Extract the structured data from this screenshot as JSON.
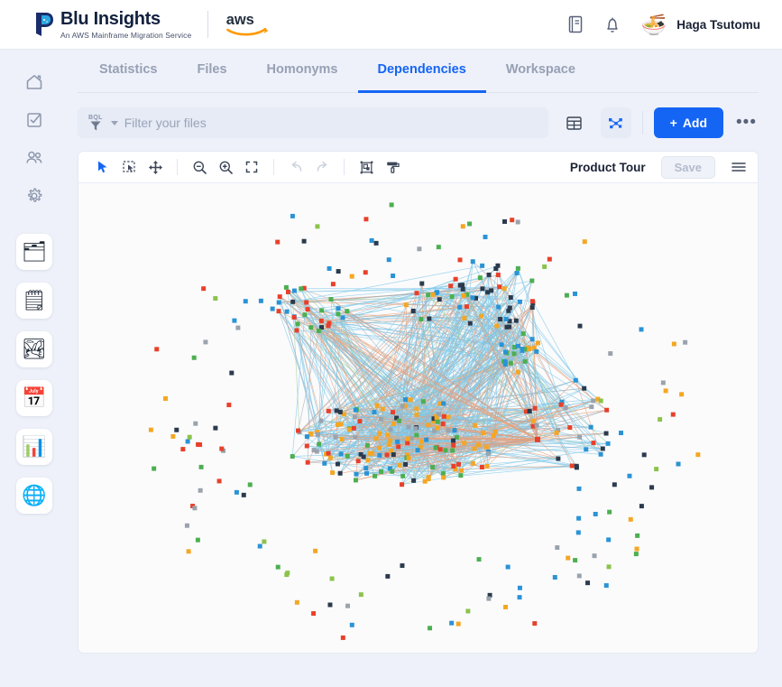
{
  "header": {
    "brand_name": "Blu Insights",
    "brand_tagline": "An AWS Mainframe Migration Service",
    "aws_label": "aws",
    "docs_icon": "book-icon",
    "bell_icon": "bell-icon",
    "avatar_icon": "ramen-bowl-avatar",
    "avatar_glyph": "🍜",
    "user_name": "Haga Tsutomu"
  },
  "sidebar": {
    "nav": [
      {
        "name": "home",
        "icon": "home-icon"
      },
      {
        "name": "tasks",
        "icon": "checkbox-icon"
      },
      {
        "name": "users",
        "icon": "users-icon"
      },
      {
        "name": "settings",
        "icon": "gear-icon"
      }
    ],
    "apps": [
      {
        "name": "files-project",
        "icon": "orange-folder-icon",
        "glyph": "🗂"
      },
      {
        "name": "notes-project",
        "icon": "notes-stack-icon",
        "glyph": "🗒"
      },
      {
        "name": "images-project",
        "icon": "photos-stack-icon",
        "glyph": "🏞"
      },
      {
        "name": "calendar-project",
        "icon": "calendar-clock-icon",
        "glyph": "📅"
      },
      {
        "name": "dashboard-project",
        "icon": "dashboard-chart-icon",
        "glyph": "📊"
      },
      {
        "name": "explorer-project",
        "icon": "globe-search-icon",
        "glyph": "🌐"
      }
    ]
  },
  "tabs": [
    {
      "label": "Statistics",
      "active": false
    },
    {
      "label": "Files",
      "active": false
    },
    {
      "label": "Homonyms",
      "active": false
    },
    {
      "label": "Dependencies",
      "active": true
    },
    {
      "label": "Workspace",
      "active": false
    }
  ],
  "filter": {
    "mode_label": "BQL",
    "funnel_icon": "filter-funnel-icon",
    "caret_icon": "chevron-down-icon",
    "placeholder": "Filter your files",
    "value": ""
  },
  "view_actions": {
    "table_view_icon": "table-view-icon",
    "graph_view_icon": "graph-view-icon",
    "graph_view_selected": true,
    "add_label": "Add",
    "add_plus": "+",
    "more_label": "•••",
    "more_icon": "ellipsis-icon"
  },
  "graph_toolbar": {
    "tools": [
      {
        "name": "select-pointer-tool",
        "icon": "cursor-arrow-icon",
        "active": true,
        "disabled": false
      },
      {
        "name": "marquee-select-tool",
        "icon": "marquee-select-icon",
        "active": false,
        "disabled": false
      },
      {
        "name": "pan-move-tool",
        "icon": "move-arrows-icon",
        "active": false,
        "disabled": false
      },
      {
        "name": "zoom-out-tool",
        "icon": "zoom-out-icon",
        "active": false,
        "disabled": false
      },
      {
        "name": "zoom-in-tool",
        "icon": "zoom-in-icon",
        "active": false,
        "disabled": false
      },
      {
        "name": "fit-to-screen-tool",
        "icon": "fit-screen-icon",
        "active": false,
        "disabled": false
      },
      {
        "name": "undo-tool",
        "icon": "undo-arrow-icon",
        "active": false,
        "disabled": true
      },
      {
        "name": "redo-tool",
        "icon": "redo-arrow-icon",
        "active": false,
        "disabled": true
      },
      {
        "name": "group-frame-tool",
        "icon": "group-frame-icon",
        "active": false,
        "disabled": false
      },
      {
        "name": "paint-style-tool",
        "icon": "paint-roller-icon",
        "active": false,
        "disabled": false
      }
    ],
    "product_tour_label": "Product Tour",
    "save_label": "Save",
    "save_disabled": true,
    "menu_icon": "hamburger-menu-icon"
  },
  "graph": {
    "node_palette": {
      "orange": "#f5a623",
      "green": "#4caf50",
      "blue": "#2a93d5",
      "red": "#e8402a",
      "navy": "#2b3a4d",
      "gray": "#9aa3ad",
      "lightgreen": "#8bc34a"
    },
    "edge_palette": {
      "light_blue": "#7ec8e8",
      "orange": "#e8a07a",
      "gray": "#a8adb6",
      "green": "#a5cf9a"
    },
    "node_count": 420,
    "node_size": 5
  },
  "colors": {
    "accent": "#1565f5",
    "page_bg": "#eef1f9",
    "panel_bg": "#ffffff",
    "canvas_bg": "#fbfbfc",
    "muted_text": "#97a0b5"
  }
}
